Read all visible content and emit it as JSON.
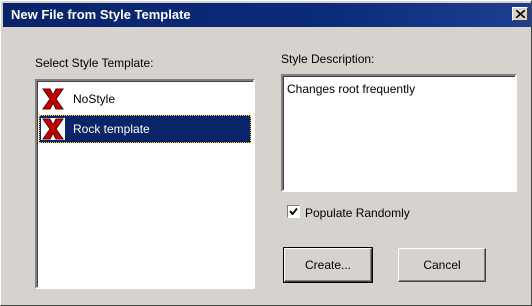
{
  "window": {
    "title": "New File from Style Template"
  },
  "left_panel": {
    "label": "Select Style Template:",
    "items": [
      {
        "label": "NoStyle",
        "icon": "red-x-icon",
        "selected": false
      },
      {
        "label": "Rock template",
        "icon": "red-x-icon",
        "selected": true
      }
    ]
  },
  "right_panel": {
    "label": "Style Description:",
    "description": "Changes root frequently",
    "populate_checkbox": {
      "label": "Populate Randomly",
      "checked": true
    }
  },
  "buttons": {
    "create": "Create...",
    "cancel": "Cancel"
  },
  "colors": {
    "title_bar": "#0a246a",
    "selection": "#0a246a",
    "x_icon": "#c00000"
  }
}
